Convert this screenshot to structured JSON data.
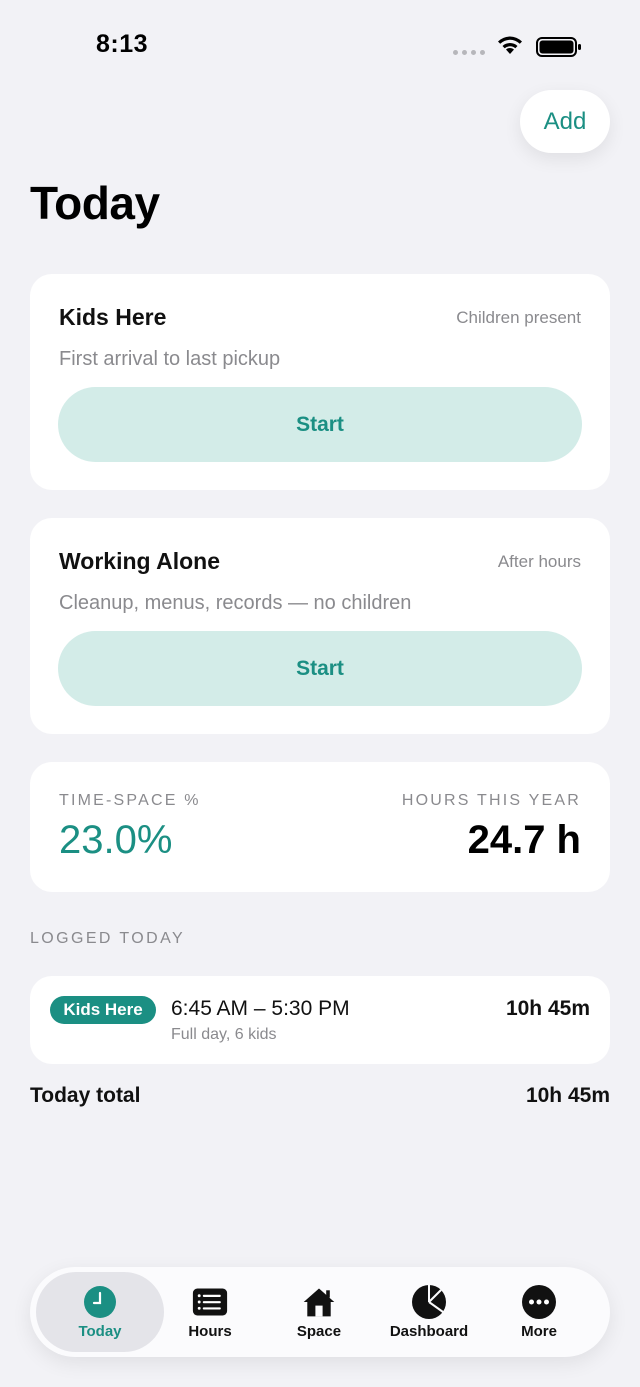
{
  "status_bar": {
    "time": "8:13"
  },
  "header": {
    "add_label": "Add",
    "title": "Today"
  },
  "cards": [
    {
      "title": "Kids Here",
      "tag": "Children present",
      "subtitle": "First arrival to last pickup",
      "button_label": "Start"
    },
    {
      "title": "Working Alone",
      "tag": "After hours",
      "subtitle": "Cleanup, menus, records — no children",
      "button_label": "Start"
    }
  ],
  "stats": {
    "time_space_label": "TIME-SPACE %",
    "time_space_value": "23.0%",
    "hours_label": "HOURS THIS YEAR",
    "hours_value": "24.7 h"
  },
  "logged": {
    "header": "LOGGED TODAY",
    "entries": [
      {
        "badge": "Kids Here",
        "time_range": "6:45 AM – 5:30 PM",
        "detail": "Full day, 6 kids",
        "duration": "10h 45m"
      }
    ],
    "total_label": "Today total",
    "total_value": "10h 45m"
  },
  "tab_bar": {
    "tabs": [
      {
        "label": "Today",
        "icon": "clock-icon",
        "active": true
      },
      {
        "label": "Hours",
        "icon": "list-icon",
        "active": false
      },
      {
        "label": "Space",
        "icon": "house-icon",
        "active": false
      },
      {
        "label": "Dashboard",
        "icon": "pie-chart-icon",
        "active": false
      },
      {
        "label": "More",
        "icon": "more-icon",
        "active": false
      }
    ]
  },
  "colors": {
    "accent": "#1b8f83",
    "accent_light": "#d3ece8",
    "background": "#f2f2f6"
  }
}
